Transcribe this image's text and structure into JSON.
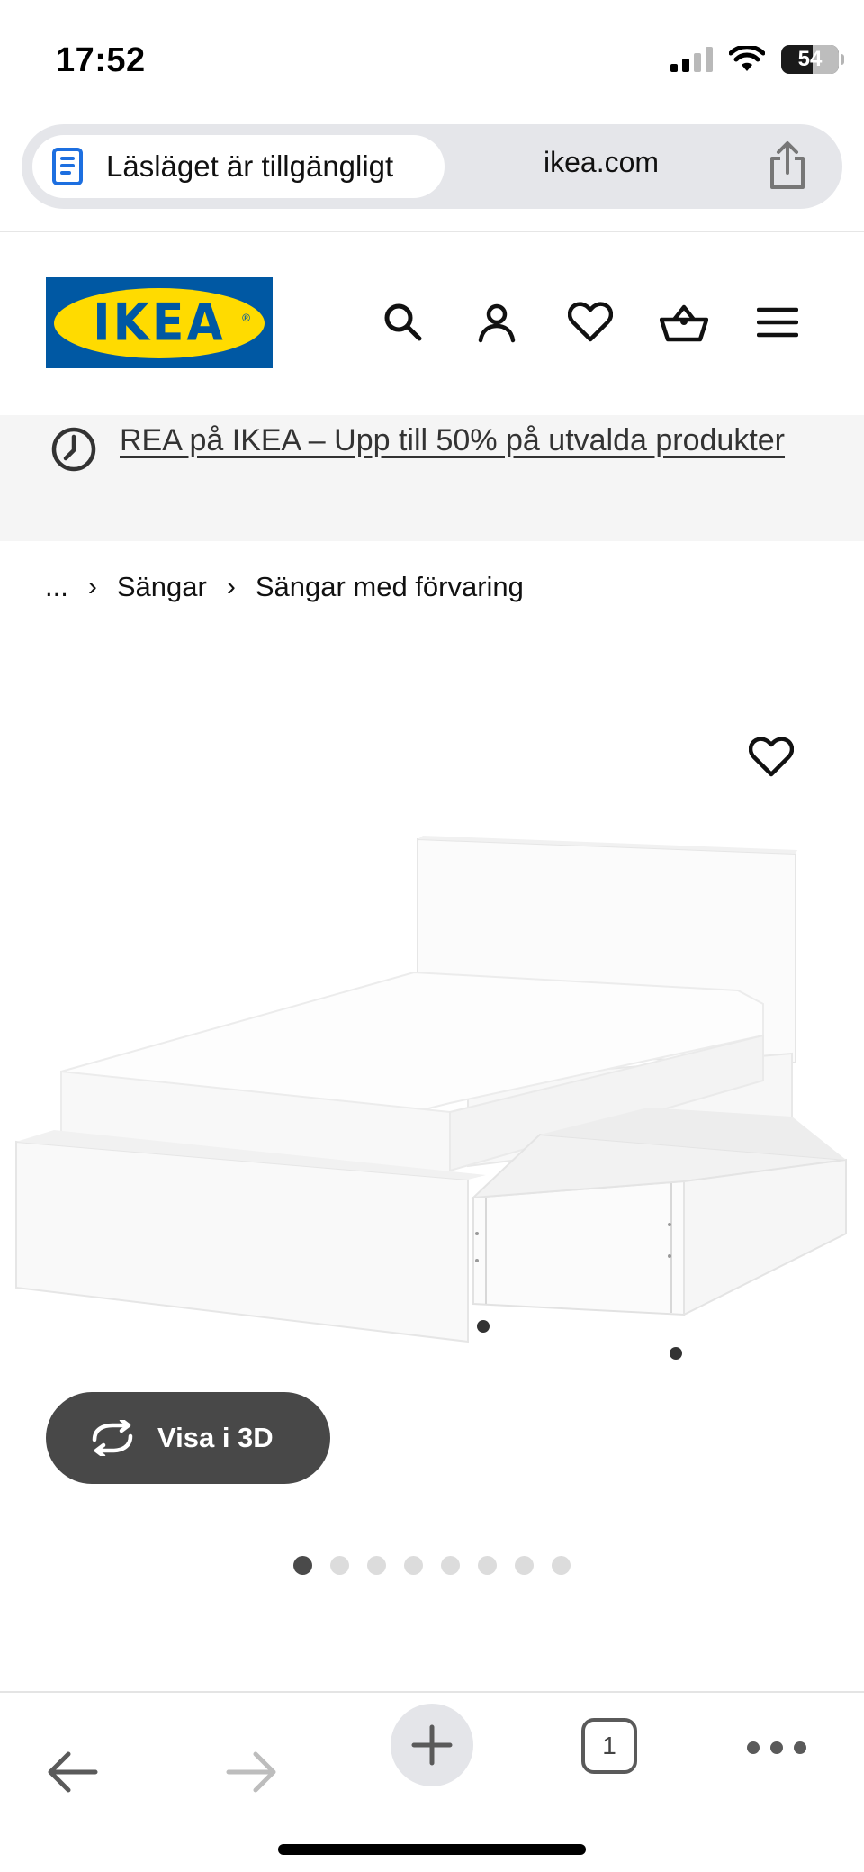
{
  "status_bar": {
    "time": "17:52",
    "battery": "54",
    "battery_fraction": 0.54,
    "icons": [
      "cellular-signal-icon",
      "wifi-icon",
      "battery-icon"
    ]
  },
  "browser": {
    "reader_mode_label": "Läsläget är tillgängligt",
    "url": "ikea.com",
    "tab_count": "1",
    "icons": [
      "reader-mode-icon",
      "share-icon",
      "back-arrow-icon",
      "forward-arrow-icon",
      "new-tab-plus-icon",
      "tabs-icon",
      "more-icon"
    ]
  },
  "header": {
    "logo_text": "IKEA",
    "nav_icons": [
      "search-icon",
      "account-icon",
      "favorites-heart-icon",
      "cart-icon",
      "menu-icon"
    ]
  },
  "promo": {
    "text": "REA på IKEA – Upp till 50% på utvalda produkter",
    "icon": "clock-icon"
  },
  "breadcrumb": {
    "items": [
      "...",
      "Sängar",
      "Sängar med förvaring"
    ]
  },
  "product": {
    "view_3d_label": "Visa i 3D",
    "image_count": 8,
    "active_image_index": 0
  },
  "colors": {
    "ikea_blue": "#0058a3",
    "ikea_yellow": "#ffdb00",
    "reader_icon_blue": "#1d6fe0",
    "button_dark": "#484848",
    "promo_bg": "#f5f5f5"
  }
}
